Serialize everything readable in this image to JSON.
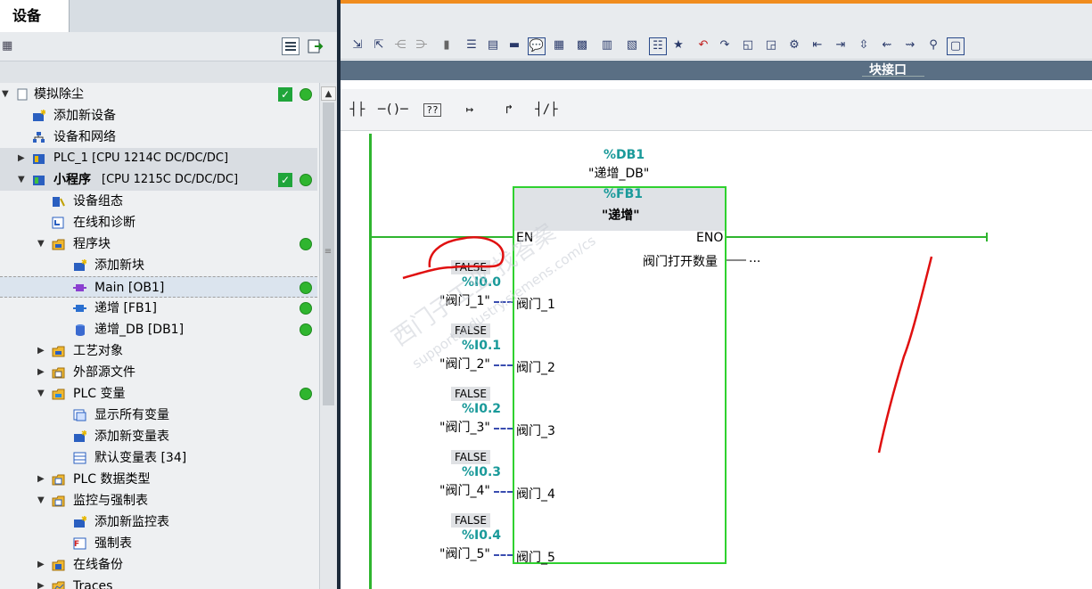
{
  "project_panel": {
    "tab_label": "设备",
    "tree": [
      {
        "label": "模拟除尘",
        "status_check": true,
        "status_dot": true
      },
      {
        "label": "添加新设备"
      },
      {
        "label": "设备和网络"
      },
      {
        "label": "PLC_1 [CPU 1214C DC/DC/DC]"
      },
      {
        "label": "小程序",
        "suffix": "[CPU 1215C DC/DC/DC]",
        "status_check": true,
        "status_dot": true
      },
      {
        "label": "设备组态"
      },
      {
        "label": "在线和诊断"
      },
      {
        "label": "程序块",
        "status_dot": true
      },
      {
        "label": "添加新块"
      },
      {
        "label": "Main [OB1]",
        "status_dot": true
      },
      {
        "label": "递增 [FB1]",
        "status_dot": true
      },
      {
        "label": "递增_DB [DB1]",
        "status_dot": true
      },
      {
        "label": "工艺对象"
      },
      {
        "label": "外部源文件"
      },
      {
        "label": "PLC 变量",
        "status_dot": true
      },
      {
        "label": "显示所有变量"
      },
      {
        "label": "添加新变量表"
      },
      {
        "label": "默认变量表 [34]"
      },
      {
        "label": "PLC 数据类型"
      },
      {
        "label": "监控与强制表"
      },
      {
        "label": "添加新监控表"
      },
      {
        "label": "强制表"
      },
      {
        "label": "在线备份"
      },
      {
        "label": "Traces"
      }
    ]
  },
  "editor": {
    "block_interface_label": "块接口",
    "ladder_toolbar": [
      "┤├",
      "─()─",
      "??",
      "↦",
      "↱",
      "┤/├"
    ],
    "instance_db": {
      "address": "%DB1",
      "name": "\"递增_DB\""
    },
    "fb": {
      "address": "%FB1",
      "name": "\"递增\"",
      "en": "EN",
      "eno": "ENO"
    },
    "output": {
      "name": "阀门打开数量",
      "value": "..."
    },
    "inputs": [
      {
        "status": "FALSE",
        "address": "%I0.0",
        "tag": "\"阀门_1\"",
        "pin": "阀门_1"
      },
      {
        "status": "FALSE",
        "address": "%I0.1",
        "tag": "\"阀门_2\"",
        "pin": "阀门_2"
      },
      {
        "status": "FALSE",
        "address": "%I0.2",
        "tag": "\"阀门_3\"",
        "pin": "阀门_3"
      },
      {
        "status": "FALSE",
        "address": "%I0.3",
        "tag": "\"阀门_4\"",
        "pin": "阀门_4"
      },
      {
        "status": "FALSE",
        "address": "%I0.4",
        "tag": "\"阀门_5\"",
        "pin": "阀门_5"
      }
    ],
    "watermark": {
      "line1": "西门子工业  找答案",
      "line2": "support.industry.siemens.com/cs"
    }
  },
  "colors": {
    "wire": "#2fb52f",
    "accent": "#f08c1e",
    "annotation": "#e01010"
  }
}
